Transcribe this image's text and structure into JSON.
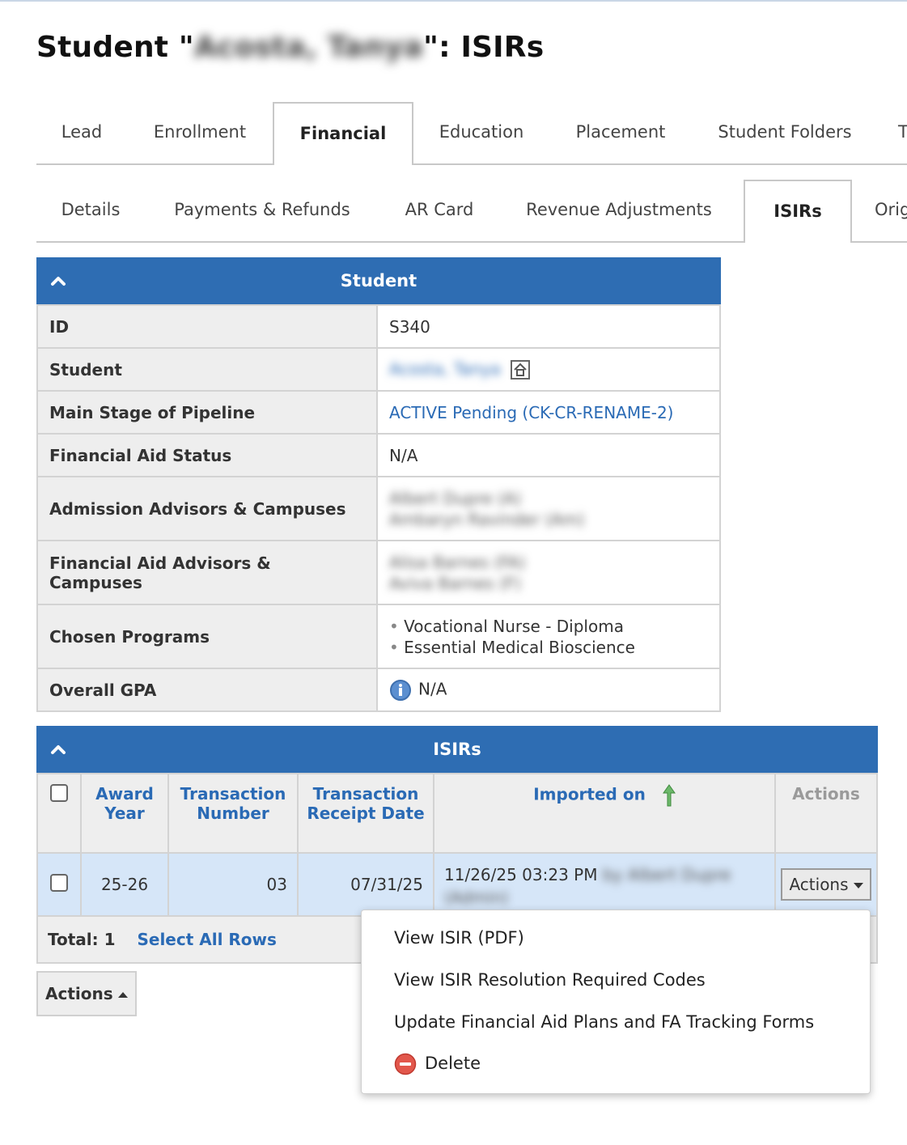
{
  "page": {
    "title_prefix": "Student \"",
    "title_blurred": "Acosta, Tanya",
    "title_suffix": "\": ISIRs"
  },
  "main_tabs": [
    "Lead",
    "Enrollment",
    "Financial",
    "Education",
    "Placement",
    "Student Folders"
  ],
  "main_tabs_active": "Financial",
  "sub_tabs": [
    "Details",
    "Payments & Refunds",
    "AR Card",
    "Revenue Adjustments",
    "ISIRs",
    "Orig"
  ],
  "sub_tabs_active": "ISIRs",
  "student_panel": {
    "title": "Student",
    "rows": [
      {
        "label": "ID",
        "value": "S340"
      },
      {
        "label": "Student",
        "value": "Acosta, Tanya"
      },
      {
        "label": "Main Stage of Pipeline",
        "value": "ACTIVE Pending (CK-CR-RENAME-2)"
      },
      {
        "label": "Financial Aid Status",
        "value": "N/A"
      },
      {
        "label": "Admission Advisors & Campuses",
        "value_lines": [
          "Albert Dupre (A)",
          "Ambaryn Ravinder (Am)"
        ]
      },
      {
        "label": "Financial Aid Advisors & Campuses",
        "value_lines": [
          "Alisa Barnes (FA)",
          "Aviva Barnes (F)"
        ]
      },
      {
        "label": "Chosen Programs",
        "value_lines": [
          "Vocational Nurse - Diploma",
          "Essential Medical Bioscience"
        ]
      },
      {
        "label": "Overall GPA",
        "value": "N/A"
      }
    ]
  },
  "isir_panel": {
    "title": "ISIRs",
    "columns": {
      "award_year": "Award Year",
      "transaction_number": "Transaction Number",
      "transaction_receipt_date": "Transaction Receipt Date",
      "imported_on": "Imported on",
      "actions": "Actions"
    },
    "rows": [
      {
        "award_year": "25-26",
        "transaction_number": "03",
        "transaction_receipt_date": "07/31/25",
        "imported_on": "11/26/25 03:23 PM",
        "imported_by": "by Albert Dupre (Admin)",
        "actions_label": "Actions"
      }
    ],
    "total_label": "Total: 1",
    "select_all": "Select All Rows"
  },
  "bottom_actions_label": "Actions",
  "dropdown_menu": {
    "items": [
      "View ISIR (PDF)",
      "View ISIR Resolution Required Codes",
      "Update Financial Aid Plans and FA Tracking Forms",
      "Delete"
    ]
  },
  "colors": {
    "panel_header": "#2e6db3",
    "link": "#2a6ab5",
    "row_highlight": "#d6e6f8",
    "label_bg": "#eeeeee"
  },
  "icons": {
    "collapse": "chevron-up-icon",
    "student_home": "home-icon",
    "gpa_info": "info-icon",
    "sort": "sort-up-arrow-icon",
    "delete": "delete-icon"
  }
}
